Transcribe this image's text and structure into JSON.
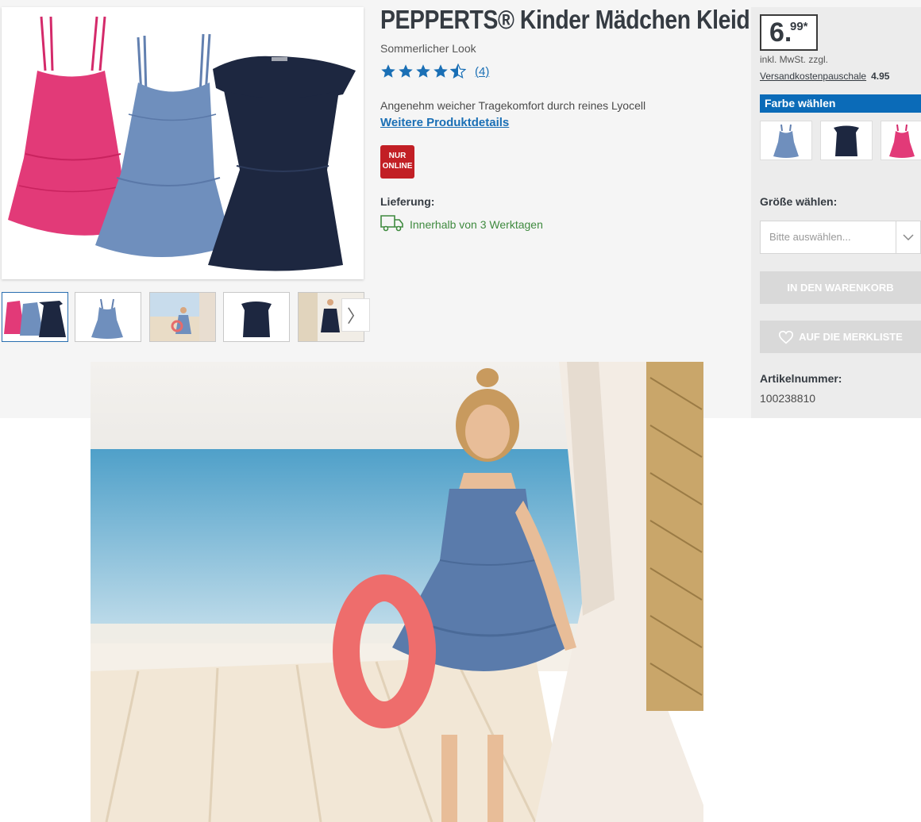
{
  "product": {
    "title": "PEPPERTS® Kinder Mädchen Kleid",
    "subtitle": "Sommerlicher Look",
    "rating_value": 4.5,
    "rating_max": 5,
    "review_count": "(4)",
    "description": "Angenehm weicher Tragekomfort durch reines Lyocell",
    "details_link": "Weitere Produktdetails",
    "badge_line1": "NUR",
    "badge_line2": "ONLINE",
    "delivery_label": "Lieferung:",
    "delivery_text": "Innerhalb von 3 Werktagen"
  },
  "gallery": {
    "thumbnails": [
      "three-dresses",
      "blue-dress",
      "girl-beach",
      "navy-dress",
      "girl-navy-dress"
    ],
    "next_icon": "chevron-right-icon"
  },
  "buy": {
    "price_main": "6.",
    "price_cents": "99*",
    "tax_note": "inkl. MwSt. zzgl.",
    "shipping_label": "Versandkostenpauschale",
    "shipping_value": "4.95",
    "color_header": "Farbe wählen",
    "size_label": "Größe wählen:",
    "size_placeholder": "Bitte auswählen...",
    "cart_button": "IN DEN WARENKORB",
    "wishlist_button": "AUF DIE MERKLISTE",
    "article_label": "Artikelnummer:",
    "article_number": "100238810"
  },
  "colors": {
    "accent_blue": "#0b6bb8",
    "link_blue": "#1a6fb5",
    "badge_red": "#c21f25",
    "delivery_green": "#3f8a3f",
    "dress_pink": "#e23a78",
    "dress_blue": "#6f8fbd",
    "dress_navy": "#1d2740"
  }
}
